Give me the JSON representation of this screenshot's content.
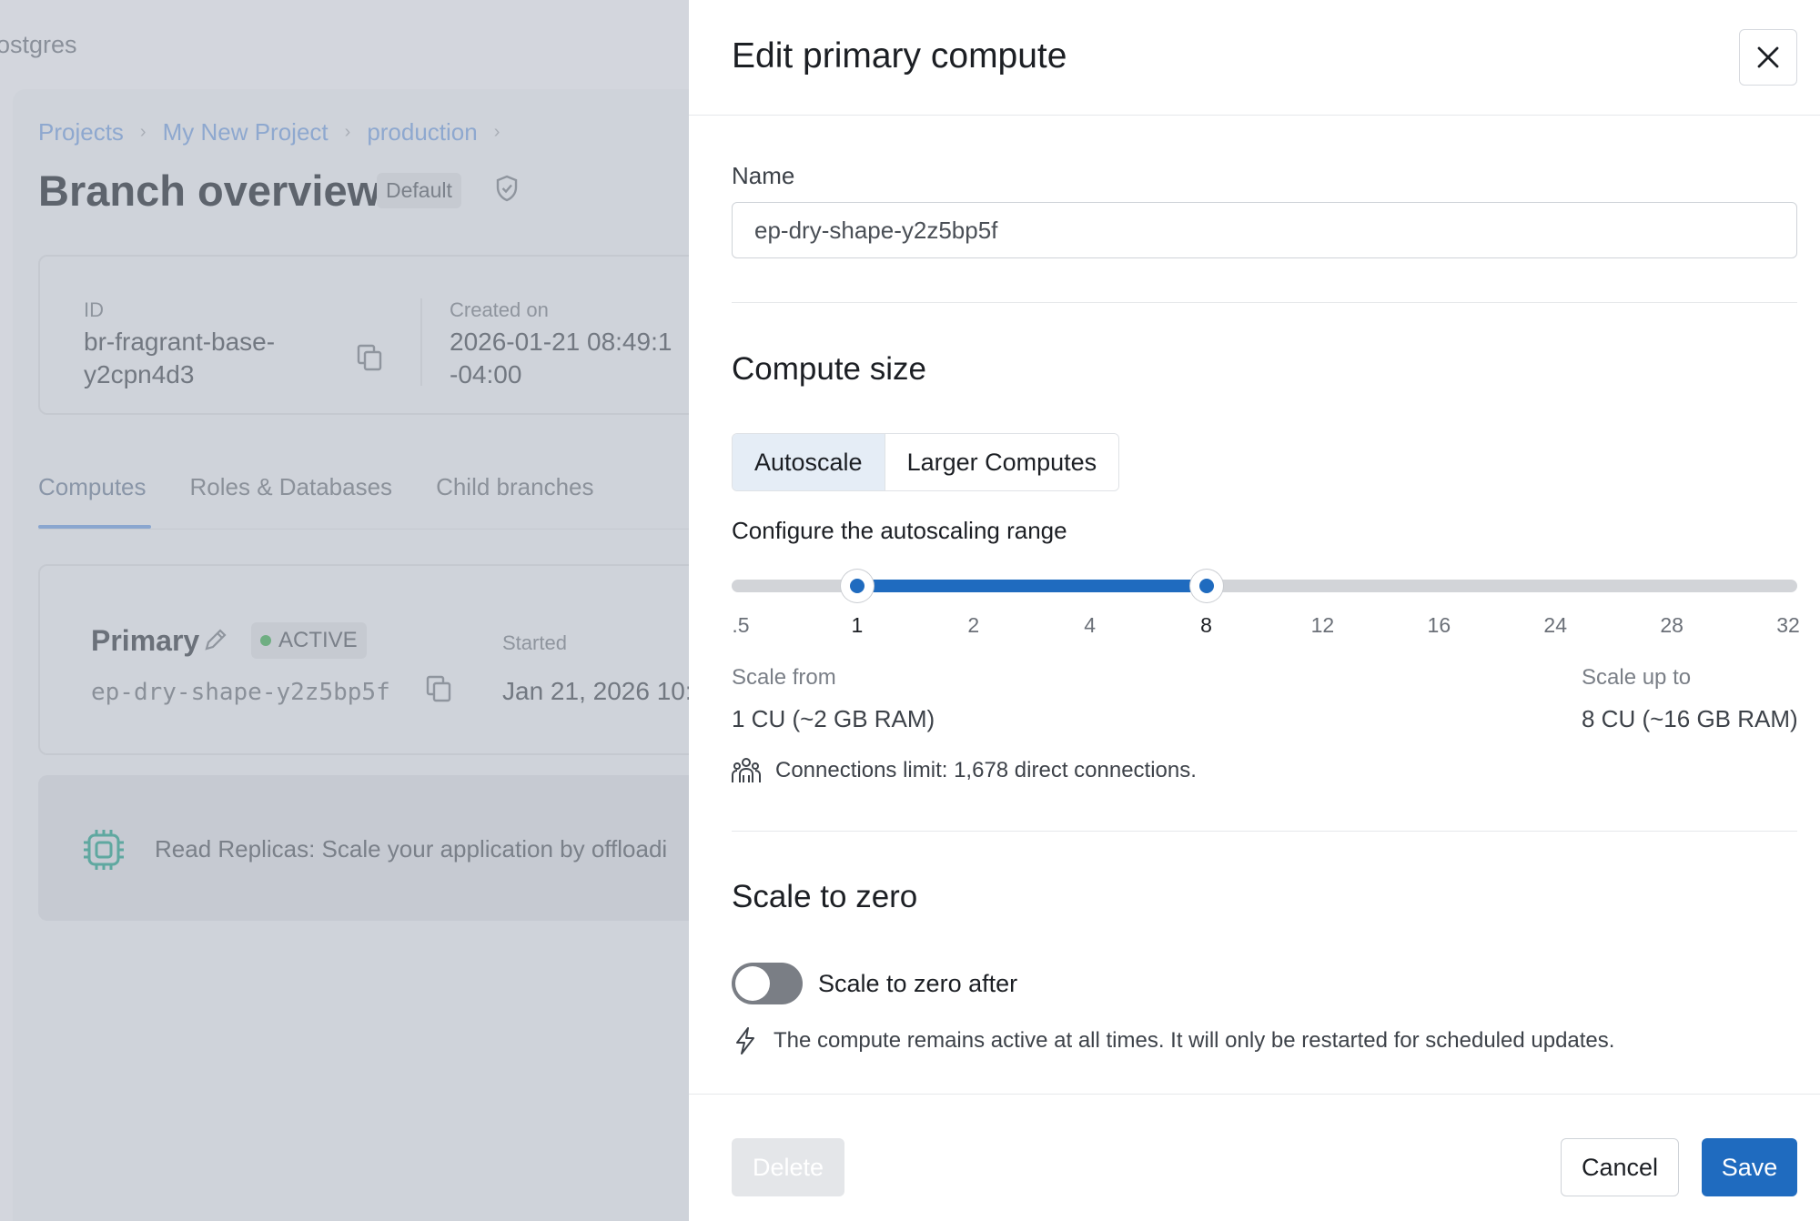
{
  "background": {
    "app_title": "ostgres",
    "breadcrumb": [
      "Projects",
      "My New Project",
      "production"
    ],
    "page_title": "Branch overview",
    "default_badge": "Default",
    "id_label": "ID",
    "id_value_line1": "br-fragrant-base-",
    "id_value_line2": "y2cpn4d3",
    "created_label": "Created on",
    "created_value_line1": "2026-01-21 08:49:1",
    "created_value_line2": "-04:00",
    "tabs": [
      "Computes",
      "Roles & Databases",
      "Child branches"
    ],
    "primary_label": "Primary",
    "status_badge": "ACTIVE",
    "started_label": "Started",
    "endpoint": "ep-dry-shape-y2z5bp5f",
    "started_value": "Jan 21, 2026 10:",
    "replica_text": "Read Replicas: Scale your application by offloadi"
  },
  "drawer": {
    "title": "Edit primary compute",
    "name_label": "Name",
    "name_value": "ep-dry-shape-y2z5bp5f",
    "compute_size_title": "Compute size",
    "mode_tabs": [
      "Autoscale",
      "Larger Computes"
    ],
    "active_mode": "Autoscale",
    "configure_label": "Configure the autoscaling range",
    "slider": {
      "ticks": [
        ".5",
        "1",
        "2",
        "4",
        "8",
        "12",
        "16",
        "24",
        "28",
        "32"
      ],
      "min_index": 1,
      "max_index": 4,
      "accent": "#1f6bbf"
    },
    "scale_from_label": "Scale from",
    "scale_from_value": "1 CU (~2 GB RAM)",
    "scale_up_label": "Scale up to",
    "scale_up_value": "8 CU (~16 GB RAM)",
    "connections_text": "Connections limit: 1,678 direct connections.",
    "scale_to_zero_title": "Scale to zero",
    "toggle_label": "Scale to zero after",
    "toggle_on": false,
    "active_note": "The compute remains active at all times. It will only be restarted for scheduled updates.",
    "buttons": {
      "delete": "Delete",
      "cancel": "Cancel",
      "save": "Save"
    }
  },
  "icons": {
    "close": "close-icon",
    "copy": "copy-icon",
    "shield": "shield-icon",
    "pencil": "pencil-icon",
    "chip": "chip-icon",
    "connections": "users-icon",
    "bolt": "bolt-icon"
  }
}
